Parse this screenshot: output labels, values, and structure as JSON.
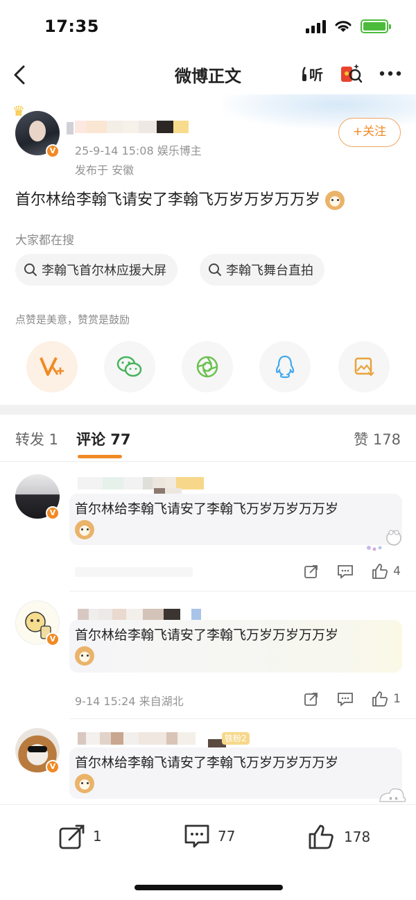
{
  "status": {
    "time": "17:35"
  },
  "nav": {
    "title": "微博正文",
    "listen_label": "听"
  },
  "author": {
    "meta": "25-9-14 15:08  娱乐博主",
    "location": "发布于 安徽",
    "follow_label": "+关注"
  },
  "post": {
    "text": "首尔林给李翰飞请安了李翰飞万岁万岁万万岁"
  },
  "hot_search": {
    "label": "大家都在搜",
    "chips": [
      "李翰飞首尔林应援大屏",
      "李翰飞舞台直拍"
    ]
  },
  "reward_hint": "点赞是美意，赞赏是鼓励",
  "share_icons": [
    "weibo-v-plus-icon",
    "wechat-icon",
    "moments-icon",
    "qq-icon",
    "save-image-icon"
  ],
  "tabs": {
    "repost": "转发 1",
    "comments": "评论 77",
    "likes": "赞 178"
  },
  "comments": [
    {
      "text": "首尔林给李翰飞请安了李翰飞万岁万岁万万岁",
      "time": "",
      "likes": "4"
    },
    {
      "text": "首尔林给李翰飞请安了李翰飞万岁万岁万万岁",
      "time": "9-14 15:24  来自湖北",
      "likes": "1"
    },
    {
      "text": "首尔林给李翰飞请安了李翰飞万岁万岁万万岁",
      "time": "",
      "likes": "",
      "fan_badge": "铁粉2"
    }
  ],
  "bottom_bar": {
    "repost_count": "1",
    "comment_count": "77",
    "like_count": "178"
  },
  "colors": {
    "accent": "#f08a24",
    "green": "#4cbb3b",
    "muted": "#939393"
  }
}
